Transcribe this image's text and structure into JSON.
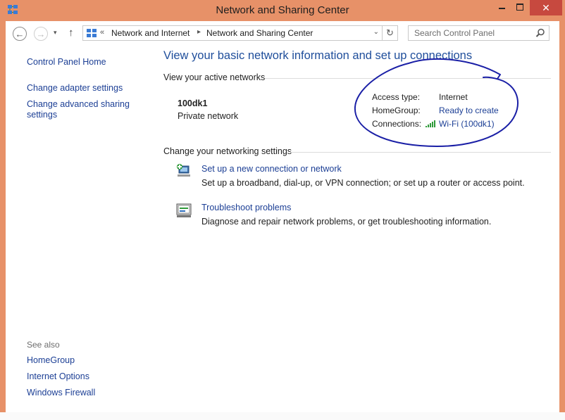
{
  "window": {
    "title": "Network and Sharing Center",
    "close_glyph": "✕",
    "icon": "network-icon"
  },
  "navbar": {
    "back_glyph": "←",
    "forward_glyph": "→",
    "recent_glyph": "▾",
    "up_glyph": "↑",
    "address_prefix": "«",
    "breadcrumbs": [
      "Network and Internet",
      "Network and Sharing Center"
    ],
    "crumb_separator": "▸",
    "dropdown_glyph": "⌄",
    "refresh_glyph": "↻",
    "search_placeholder": "Search Control Panel"
  },
  "sidebar": {
    "home": "Control Panel Home",
    "adapter": "Change adapter settings",
    "advanced": "Change advanced sharing settings",
    "see_also_heading": "See also",
    "see_also": [
      "HomeGroup",
      "Internet Options",
      "Windows Firewall"
    ]
  },
  "main": {
    "title": "View your basic network information and set up connections",
    "active_networks_heading": "View your active networks",
    "network": {
      "name": "100dk1",
      "type": "Private network",
      "access_type_label": "Access type:",
      "access_type_value": "Internet",
      "homegroup_label": "HomeGroup:",
      "homegroup_value": "Ready to create",
      "connections_label": "Connections:",
      "connections_value": "Wi-Fi (100dk1)"
    },
    "settings_heading": "Change your networking settings",
    "tasks": [
      {
        "title": "Set up a new connection or network",
        "description": "Set up a broadband, dial-up, or VPN connection; or set up a router or access point."
      },
      {
        "title": "Troubleshoot problems",
        "description": "Diagnose and repair network problems, or get troubleshooting information."
      }
    ]
  },
  "colors": {
    "frame": "#e79168",
    "close_button": "#c7493f",
    "link": "#1c3f95",
    "title_blue": "#1f4e9b",
    "annotation_ink": "#1a1fa6"
  }
}
